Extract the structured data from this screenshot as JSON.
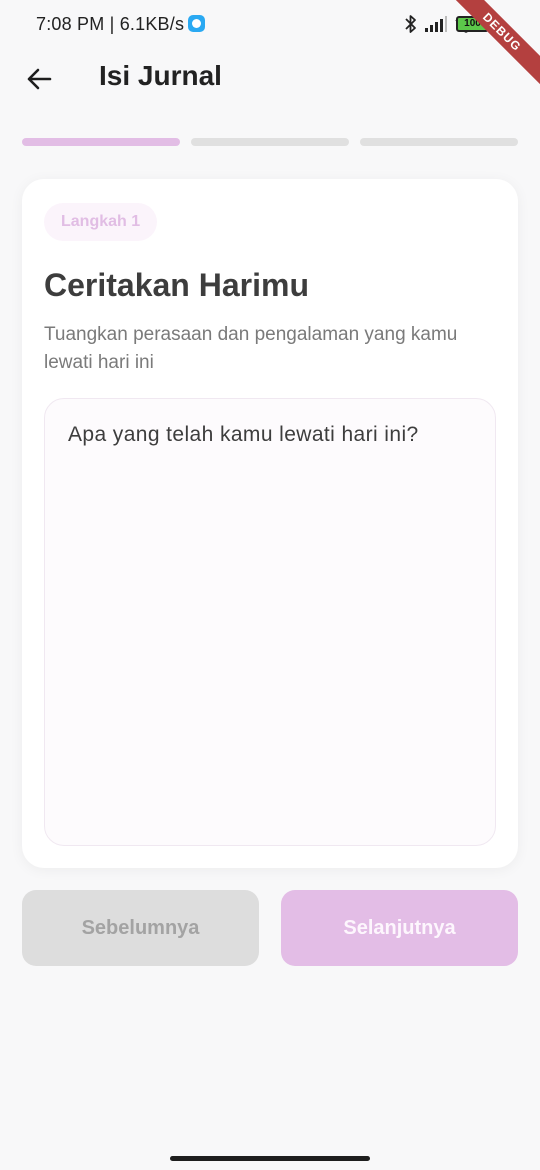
{
  "status_bar": {
    "time": "7:08 PM | 6.1KB/s",
    "battery": "100",
    "debug_label": "DEBUG",
    "icons": [
      "bluetooth-icon",
      "signal-icon",
      "wifi-icon",
      "battery-icon"
    ]
  },
  "header": {
    "title": "Isi Jurnal",
    "back_icon": "arrow-left-icon"
  },
  "progress": {
    "total_steps": 3,
    "current_step": 1,
    "active_color": "#e2bde5",
    "inactive_color": "#e0e0e0"
  },
  "card": {
    "step_label": "Langkah 1",
    "title": "Ceritakan Harimu",
    "subtitle": "Tuangkan perasaan dan pengalaman yang kamu lewati hari ini",
    "input_value": "",
    "input_placeholder": "Apa yang telah kamu lewati hari ini?"
  },
  "buttons": {
    "prev_label": "Sebelumnya",
    "next_label": "Selanjutnya"
  },
  "colors": {
    "accent": "#e3bde6",
    "background": "#f8f8f9"
  }
}
